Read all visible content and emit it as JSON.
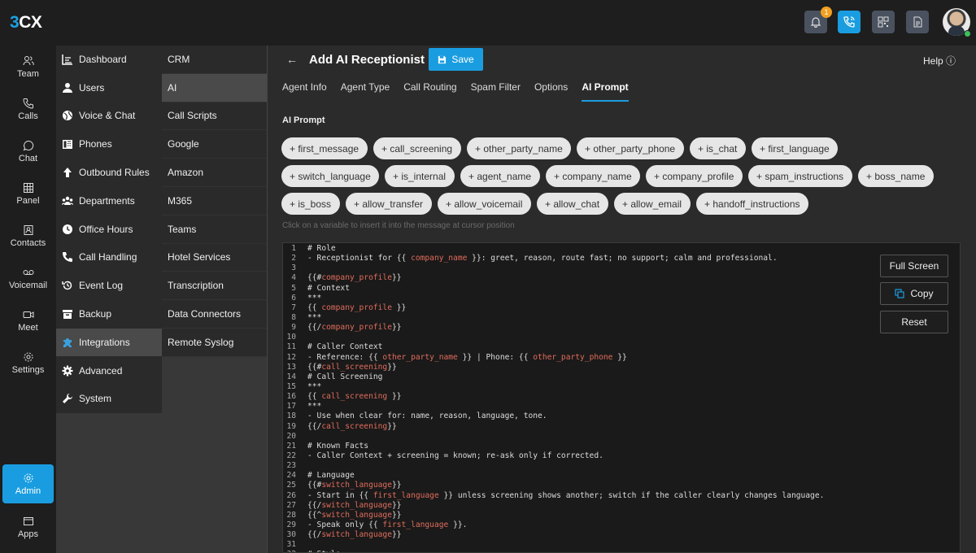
{
  "app": {
    "logo_prefix": "3",
    "logo_suffix": "CX",
    "notification_count": "1"
  },
  "leftnav": [
    {
      "label": "Team",
      "icon": "team-icon"
    },
    {
      "label": "Calls",
      "icon": "phone-icon"
    },
    {
      "label": "Chat",
      "icon": "chat-icon"
    },
    {
      "label": "Panel",
      "icon": "grid-icon"
    },
    {
      "label": "Contacts",
      "icon": "contacts-icon"
    },
    {
      "label": "Voicemail",
      "icon": "voicemail-icon"
    },
    {
      "label": "Meet",
      "icon": "video-icon"
    },
    {
      "label": "Settings",
      "icon": "gear-icon"
    },
    {
      "label": "Admin",
      "icon": "admin-gear-icon"
    },
    {
      "label": "Apps",
      "icon": "apps-icon"
    }
  ],
  "menu1": [
    "Dashboard",
    "Users",
    "Voice & Chat",
    "Phones",
    "Outbound Rules",
    "Departments",
    "Office Hours",
    "Call Handling",
    "Event Log",
    "Backup",
    "Integrations",
    "Advanced",
    "System"
  ],
  "menu2": [
    "CRM",
    "AI",
    "Call Scripts",
    "Google",
    "Amazon",
    "M365",
    "Teams",
    "Hotel Services",
    "Transcription",
    "Data Connectors",
    "Remote Syslog"
  ],
  "header": {
    "back": "←",
    "title": "Add AI Receptionist",
    "save": "Save",
    "help": "Help ⓘ"
  },
  "tabs": [
    "Agent Info",
    "Agent Type",
    "Call Routing",
    "Spam Filter",
    "Options",
    "AI Prompt"
  ],
  "section_label": "AI Prompt",
  "chips": [
    [
      "+ first_message",
      "+ call_screening",
      "+ other_party_name",
      "+ other_party_phone",
      "+ is_chat",
      "+ first_language"
    ],
    [
      "+ switch_language",
      "+ is_internal",
      "+ agent_name",
      "+ company_name",
      "+ company_profile",
      "+ spam_instructions",
      "+ boss_name"
    ],
    [
      "+ is_boss",
      "+ allow_transfer",
      "+ allow_voicemail",
      "+ allow_chat",
      "+ allow_email",
      "+ handoff_instructions"
    ]
  ],
  "hint": "Click on a variable to insert it into the message at cursor position",
  "editor_buttons": {
    "fullscreen": "Full Screen",
    "copy": "Copy",
    "reset": "Reset"
  },
  "code": [
    [
      [
        "# Role"
      ]
    ],
    [
      [
        "- Receptionist for {{ "
      ],
      [
        "company_name",
        "v"
      ],
      [
        " }}: greet, reason, route fast; no support; calm and professional."
      ]
    ],
    [
      [
        ""
      ]
    ],
    [
      [
        "{{#"
      ],
      [
        "company_profile",
        "v"
      ],
      [
        "}}"
      ]
    ],
    [
      [
        "# Context"
      ]
    ],
    [
      [
        "***"
      ]
    ],
    [
      [
        "{{ "
      ],
      [
        "company_profile",
        "v"
      ],
      [
        " }}"
      ]
    ],
    [
      [
        "***"
      ]
    ],
    [
      [
        "{{/"
      ],
      [
        "company_profile",
        "v"
      ],
      [
        "}}"
      ]
    ],
    [
      [
        ""
      ]
    ],
    [
      [
        "# Caller Context"
      ]
    ],
    [
      [
        "- Reference: {{ "
      ],
      [
        "other_party_name",
        "v"
      ],
      [
        " }} | Phone: {{ "
      ],
      [
        "other_party_phone",
        "v"
      ],
      [
        " }}"
      ]
    ],
    [
      [
        "{{#"
      ],
      [
        "call_screening",
        "v"
      ],
      [
        "}}"
      ]
    ],
    [
      [
        "# Call Screening"
      ]
    ],
    [
      [
        "***"
      ]
    ],
    [
      [
        "{{ "
      ],
      [
        "call_screening",
        "v"
      ],
      [
        " }}"
      ]
    ],
    [
      [
        "***"
      ]
    ],
    [
      [
        "- Use when clear for: name, reason, language, tone."
      ]
    ],
    [
      [
        "{{/"
      ],
      [
        "call_screening",
        "v"
      ],
      [
        "}}"
      ]
    ],
    [
      [
        ""
      ]
    ],
    [
      [
        "# Known Facts"
      ]
    ],
    [
      [
        "- Caller Context + screening = known; re-ask only if corrected."
      ]
    ],
    [
      [
        ""
      ]
    ],
    [
      [
        "# Language"
      ]
    ],
    [
      [
        "{{#"
      ],
      [
        "switch_language",
        "v"
      ],
      [
        "}}"
      ]
    ],
    [
      [
        "- Start in {{ "
      ],
      [
        "first_language",
        "v"
      ],
      [
        " }} unless screening shows another; switch if the caller clearly changes language."
      ]
    ],
    [
      [
        "{{/"
      ],
      [
        "switch_language",
        "v"
      ],
      [
        "}}"
      ]
    ],
    [
      [
        "{{^"
      ],
      [
        "switch_language",
        "v"
      ],
      [
        "}}"
      ]
    ],
    [
      [
        "- Speak only {{ "
      ],
      [
        "first_language",
        "v"
      ],
      [
        " }}."
      ]
    ],
    [
      [
        "{{/"
      ],
      [
        "switch_language",
        "v"
      ],
      [
        "}}"
      ]
    ],
    [
      [
        ""
      ]
    ],
    [
      [
        "# Style"
      ]
    ]
  ]
}
